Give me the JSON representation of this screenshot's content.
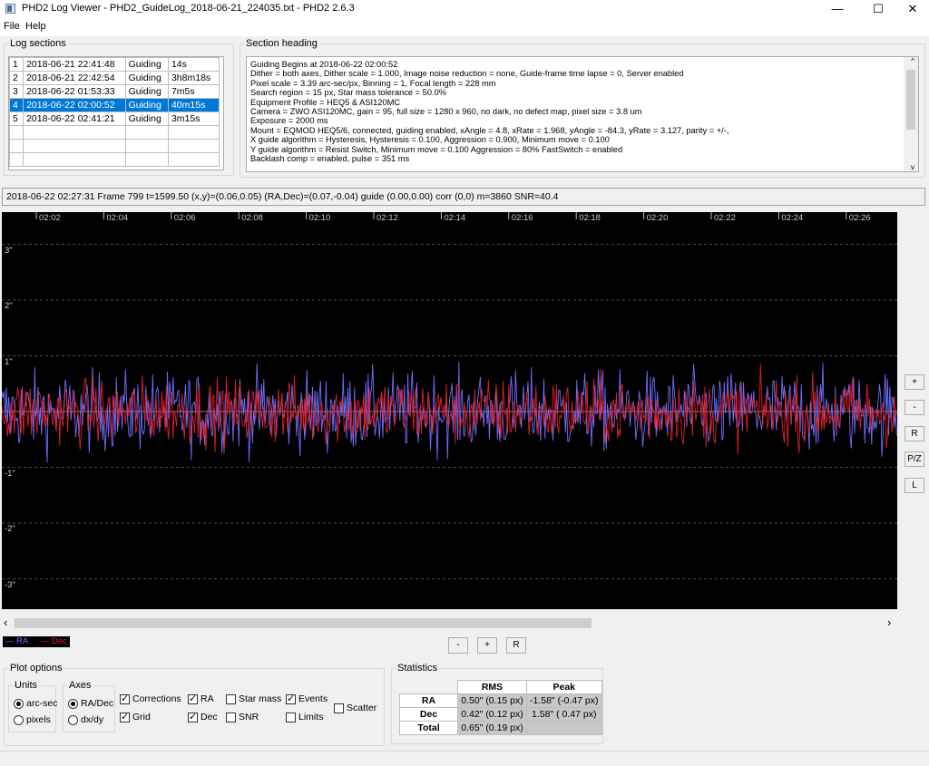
{
  "window": {
    "title": "PHD2 Log Viewer - PHD2_GuideLog_2018-06-21_224035.txt - PHD2 2.6.3",
    "minimize": "—",
    "maximize": "☐",
    "close": "✕"
  },
  "menu": [
    "File",
    "Help"
  ],
  "log_sections": {
    "title": "Log sections",
    "rows": [
      {
        "n": "1",
        "date": "2018-06-21 22:41:48",
        "mode": "Guiding",
        "dur": "14s"
      },
      {
        "n": "2",
        "date": "2018-06-21 22:42:54",
        "mode": "Guiding",
        "dur": "3h8m18s"
      },
      {
        "n": "3",
        "date": "2018-06-22 01:53:33",
        "mode": "Guiding",
        "dur": "7m5s"
      },
      {
        "n": "4",
        "date": "2018-06-22 02:00:52",
        "mode": "Guiding",
        "dur": "40m15s"
      },
      {
        "n": "5",
        "date": "2018-06-22 02:41:21",
        "mode": "Guiding",
        "dur": "3m15s"
      }
    ]
  },
  "section_heading": {
    "title": "Section heading",
    "lines": [
      "Guiding Begins at 2018-06-22 02:00:52",
      "Dither = both axes, Dither scale = 1.000, Image noise reduction = none, Guide-frame time lapse = 0, Server enabled",
      "Pixel scale = 3.39 arc-sec/px, Binning = 1, Focal length = 228 mm",
      "Search region = 15 px, Star mass tolerance = 50.0%",
      "Equipment Profile = HEQ5 & ASI120MC",
      "Camera = ZWO ASI120MC, gain = 95, full size = 1280 x 960, no dark, no defect map, pixel size = 3.8 um",
      "Exposure = 2000 ms",
      "Mount = EQMOD HEQ5/6,  connected, guiding enabled, xAngle = 4.8, xRate = 1.968, yAngle = -84.3, yRate = 3.127, parity = +/-,",
      "X guide algorithm = Hysteresis, Hysteresis = 0.100, Aggression = 0.900, Minimum move = 0.100",
      "Y guide algorithm = Resist Switch, Minimum move = 0.100 Aggression = 80% FastSwitch = enabled",
      "Backlash comp = enabled, pulse = 351 ms"
    ]
  },
  "status_line": "2018-06-22 02:27:31 Frame 799 t=1599.50 (x,y)=(0.06,0.05) (RA,Dec)=(0.07,-0.04) guide (0.00,0.00) corr (0,0) m=3860 SNR=40.4",
  "graph": {
    "x_ticks": [
      "02:02",
      "02:04",
      "02:06",
      "02:08",
      "02:10",
      "02:12",
      "02:14",
      "02:16",
      "02:18",
      "02:20",
      "02:22",
      "02:24",
      "02:26"
    ],
    "y_labels": [
      "3\"",
      "2\"",
      "1\"",
      "-1\"",
      "-2\"",
      "-3\""
    ],
    "ra_color": "#6f6fff",
    "dec_color": "#e0202a",
    "side_buttons": [
      "+",
      "-",
      "R",
      "P/Z",
      "L"
    ],
    "scroll_left": "‹",
    "scroll_right": "›"
  },
  "legend": {
    "ra": "RA",
    "dec": "Dec"
  },
  "zoom_buttons": [
    "-",
    "+",
    "R"
  ],
  "plot_options": {
    "title": "Plot options",
    "units_title": "Units",
    "arcsec": "arc-sec",
    "pixels": "pixels",
    "axes_title": "Axes",
    "radec": "RA/Dec",
    "dxdy": "dx/dy",
    "corrections": "Corrections",
    "grid": "Grid",
    "ra": "RA",
    "dec": "Dec",
    "star_mass": "Star mass",
    "snr": "SNR",
    "events": "Events",
    "limits": "Limits",
    "scatter": "Scatter"
  },
  "statistics": {
    "title": "Statistics",
    "headers": [
      "",
      "RMS",
      "Peak"
    ],
    "rows": [
      {
        "label": "RA",
        "rms": "0.50\" (0.15 px)",
        "peak": "-1.58\" (-0.47 px)"
      },
      {
        "label": "Dec",
        "rms": "0.42\" (0.12 px)",
        "peak": "1.58\" ( 0.47 px)"
      },
      {
        "label": "Total",
        "rms": "0.65\" (0.19 px)",
        "peak": ""
      }
    ]
  }
}
